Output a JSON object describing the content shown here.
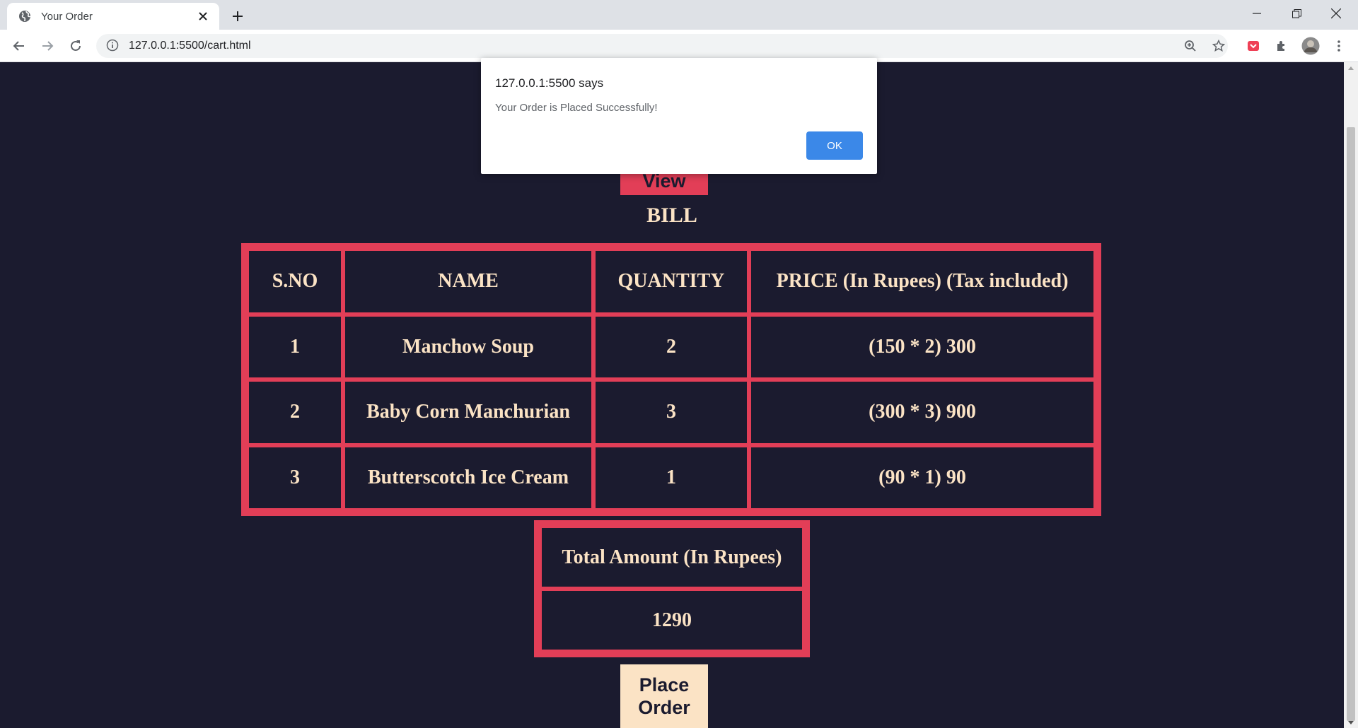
{
  "browser": {
    "tab_title": "Your Order",
    "url": "127.0.0.1:5500/cart.html"
  },
  "page": {
    "view_button_label": "View",
    "bill_heading": "BILL",
    "table": {
      "headers": [
        "S.NO",
        "NAME",
        "QUANTITY",
        "PRICE (In Rupees) (Tax included)"
      ],
      "rows": [
        [
          "1",
          "Manchow Soup",
          "2",
          "(150 * 2) 300"
        ],
        [
          "2",
          "Baby Corn Manchurian",
          "3",
          "(300 * 3) 900"
        ],
        [
          "3",
          "Butterscotch Ice Cream",
          "1",
          "(90 * 1) 90"
        ]
      ]
    },
    "total": {
      "header": "Total Amount (In Rupees)",
      "value": "1290"
    },
    "place_order_label": "Place Order"
  },
  "dialog": {
    "title": "127.0.0.1:5500 says",
    "message": "Your Order is Placed Successfully!",
    "ok_label": "OK"
  },
  "colors": {
    "page_background": "#1b1b2f",
    "accent": "#e23e57",
    "text": "#fbe3c5",
    "dialog_button": "#3b88e8"
  }
}
